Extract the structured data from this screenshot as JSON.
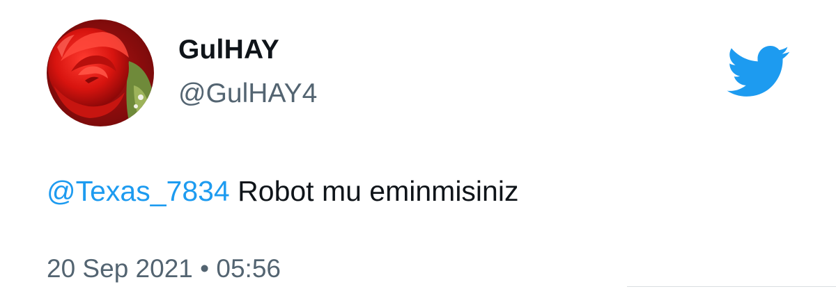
{
  "author": {
    "display_name": "GulHAY",
    "handle": "@GulHAY4",
    "avatar": "red-rose-photo"
  },
  "tweet": {
    "mention": "@Texas_7834",
    "body": "Robot mu eminmisiniz"
  },
  "meta": {
    "date": "20 Sep 2021",
    "separator": "•",
    "time": "05:56"
  },
  "icons": {
    "brand": "twitter-bird-icon"
  },
  "colors": {
    "link": "#1d9bf0",
    "brand": "#1d9bf0",
    "secondary_text": "#536471",
    "primary_text": "#0f1419"
  }
}
